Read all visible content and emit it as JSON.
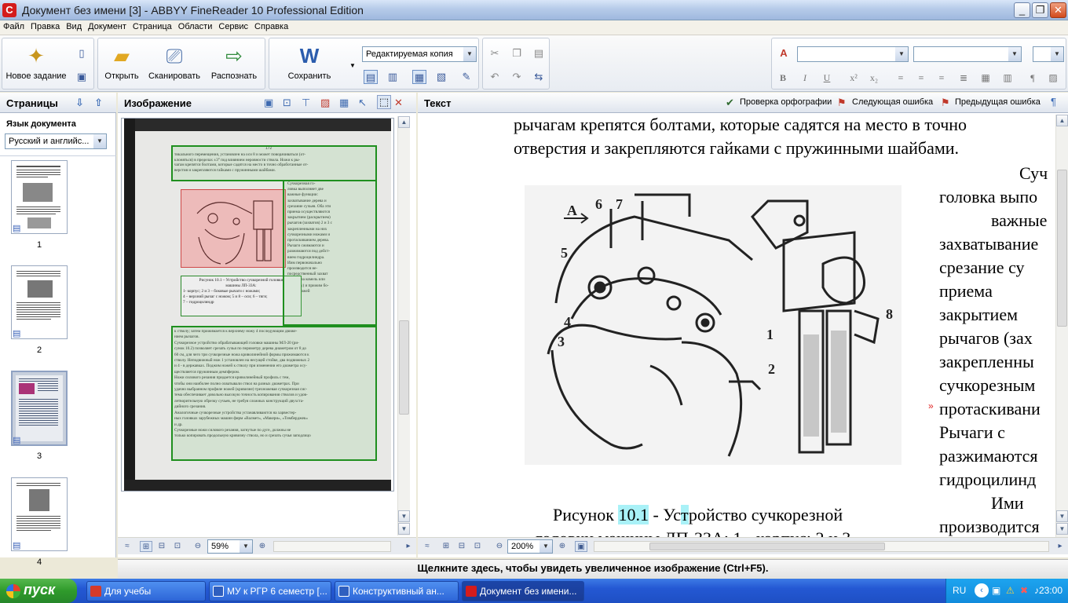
{
  "window": {
    "title": "Документ без имени [3] - ABBYY FineReader 10 Professional Edition",
    "buttons": {
      "minimize": "_",
      "restore": "❐",
      "close": "✕"
    }
  },
  "menu": [
    "Файл",
    "Правка",
    "Вид",
    "Документ",
    "Страница",
    "Области",
    "Сервис",
    "Справка"
  ],
  "toolbar": {
    "new_task": "Новое задание",
    "open": "Открыть",
    "scan": "Сканировать",
    "recognize": "Распознать",
    "save": "Сохранить",
    "save_format": "Редактируемая копия"
  },
  "pages_pane": {
    "title": "Страницы",
    "lang_label": "Язык документа",
    "lang_value": "Русский и английс...",
    "thumbs": [
      "1",
      "2",
      "3",
      "4"
    ]
  },
  "image_pane": {
    "title": "Изображение",
    "zoom": "59%",
    "page_number": "172",
    "scan_lines_top": [
      "тикального перемещения, установлен на оси 8 и может поворачиваться (от-",
      "клоняться) в пределах ±3° под влиянием неровности ствола. Ножи к ры-",
      "чагам крепятся болтами, которые садятся на место в точно обработанные от-",
      "верстия и закрепляются гайками с пружинными шайбами."
    ],
    "scan_right_col": [
      "Сучкорезная го-",
      "ловка выполняет две",
      "важные функции:",
      "захватывание дерева и",
      "срезание сучьев. Оба эти",
      "приема осуществляются",
      "закрытием (раскрытием)",
      "рычагов (захватов) 2 и 3 с",
      "закрепленными на них",
      "сучкорезными ножами и",
      "протаскиванием дерева.",
      "Рычаги сжимаются и",
      "разжимаются под дейст-",
      "вием гидроцилиндра.",
      "Иим первоначально",
      "производится не-",
      "посредственный захват",
      "дерева (за комель или",
      "вершину) и прижим бо-",
      "ковых ножей"
    ],
    "caption_lines": [
      "Рисунок 10.1 – Устройство сучкорезной головки",
      "машины ЛП-33А:",
      "1- корпус; 2 и 3 – боковые рычаги с ножами;",
      "4 – верхний рычаг с ножом; 5 и 8 – оси; 6 – тяги;",
      "7 – гидроцилиндр"
    ],
    "scan_lines_bottom": [
      "к стволу; затем прижимается к верхнему ножу 4 последующим движе-",
      "нием рычагов.",
      "Сучкорезное устройство обрабатывающей головки машины МЛ-20 (ри-",
      "сунок 10.2) позволяет срезать сучья по периметру дерева диаметром от 8 до",
      "60 см, для чего три сучкорезные ножа криволинейной формы прижимаются к",
      "стволу. Неподвижный нож 1 установлен на несущей стойке, два подвижных 2",
      "и 4 - в державках. Поджим ножей к стволу при изменении его диаметра осу-",
      "ществляется пружинным демпфером.",
      "Ножи силового резания придается криволинейный профиль с тем,",
      "чтобы они наиболее полно охватывали ствол на разных диаметрах. При",
      "удачно выбранном профиле ножей (кривизне) трехножевая сучкорезная сис-",
      "тема обеспечивает довольно высокую точность копирования стволов и удов-",
      "летворительную обрезку сучьев, не требуя сложных конструкций двухста-",
      "дийного срезания.",
      "Аналогичные сучкорезные устройства устанавливаются на харвестер-",
      "ных головках зарубежных машин фирм «Валмет», «Макери», «Тимберджек»",
      "и др.",
      "Сучкорезные ножи силового резания, загнутые по дуге, должны не",
      "только копировать продольную кривизну ствола, но и срезать сучья заподлицо"
    ]
  },
  "text_pane": {
    "title": "Текст",
    "spellcheck": "Проверка орфографии",
    "next_error": "Следующая ошибка",
    "prev_error": "Предыдущая ошибка",
    "zoom": "200%",
    "line1": "рычагам крепятся болтами, которые садятся на место в точно",
    "line2": "отверстия и закрепляются гайками с пружинными шайбами.",
    "right_col": [
      "Суч",
      "головка выпо",
      "важные",
      "захватывание",
      "срезание су",
      "приема",
      "закрытием",
      "рычагов (зах",
      "закрепленны",
      "сучкорезным",
      "протаскивани",
      "Рычаги с",
      "разжимаются",
      "гидроцилинд",
      "Ими",
      "производится"
    ],
    "caption_pre": "Рисунок",
    "caption_num": "10.1",
    "caption_mid": " - Ус",
    "caption_hl": "т",
    "caption_post": "ройство сучкорезной",
    "caption_line2": "головки машины ЛП-33А: 1 - корпус; 2 и 3",
    "figure_labels": [
      "А",
      "6",
      "7",
      "5",
      "4",
      "3",
      "1",
      "2",
      "8"
    ]
  },
  "hint_bar": "Щелкните здесь, чтобы увидеть увеличенное изображение (Ctrl+F5).",
  "taskbar": {
    "start": "пуск",
    "tasks": [
      "Для учебы",
      "МУ к РГР 6 семестр [...",
      "Конструктивный ан...",
      "Документ без имени..."
    ],
    "lang": "RU",
    "time": "23:00"
  }
}
